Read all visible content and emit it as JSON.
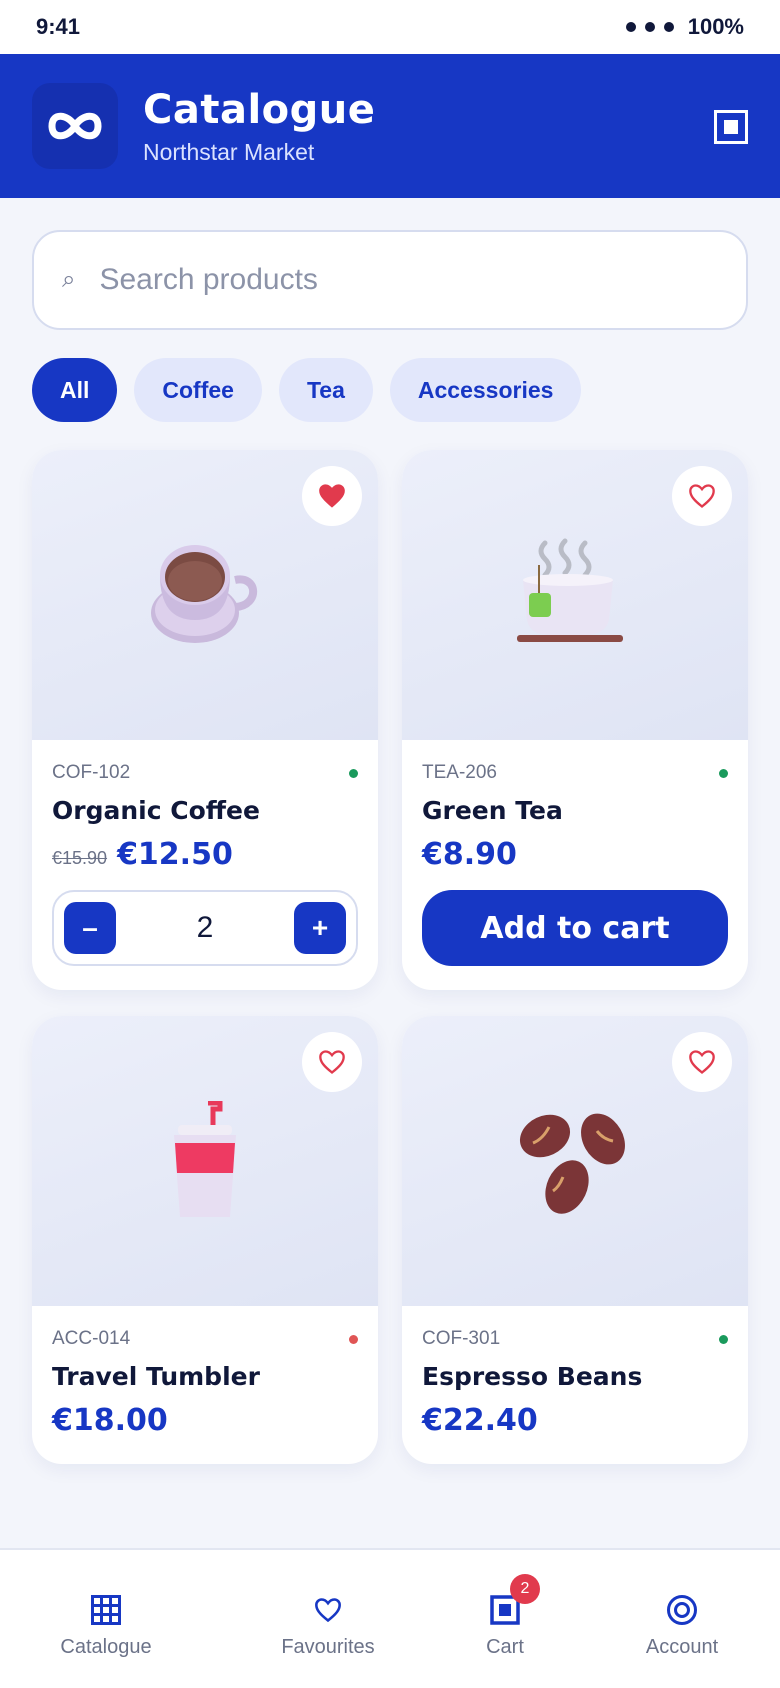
{
  "status_bar": {
    "time": "9:41",
    "battery": "100%"
  },
  "header": {
    "title": "Catalogue",
    "subtitle": "Northstar Market",
    "logo_icon": "infinity-logo-icon",
    "action_icon": "scan-icon"
  },
  "search": {
    "placeholder": "Search products",
    "value": ""
  },
  "filters": [
    {
      "label": "All",
      "active": true
    },
    {
      "label": "Coffee",
      "active": false
    },
    {
      "label": "Tea",
      "active": false
    },
    {
      "label": "Accessories",
      "active": false
    }
  ],
  "products": [
    {
      "sku": "COF-102",
      "name": "Organic Coffee",
      "old_price": "€15.90",
      "price": "€12.50",
      "favorited": true,
      "in_stock": true,
      "quantity": "2",
      "image": "coffee-cup"
    },
    {
      "sku": "TEA-206",
      "name": "Green Tea",
      "price": "€8.90",
      "favorited": false,
      "in_stock": true,
      "cta": "Add to cart",
      "image": "tea-cup"
    },
    {
      "sku": "ACC-014",
      "name": "Travel Tumbler",
      "price": "€18.00",
      "favorited": false,
      "in_stock": false,
      "image": "tumbler"
    },
    {
      "sku": "COF-301",
      "name": "Espresso Beans",
      "price": "€22.40",
      "favorited": false,
      "in_stock": true,
      "image": "coffee-beans"
    }
  ],
  "stepper": {
    "minus": "–",
    "plus": "+"
  },
  "bottom_nav": [
    {
      "label": "Catalogue",
      "icon": "grid-icon",
      "active": true
    },
    {
      "label": "Favourites",
      "icon": "heart-icon",
      "active": false
    },
    {
      "label": "Cart",
      "icon": "cart-icon",
      "active": false,
      "badge": "2"
    },
    {
      "label": "Account",
      "icon": "account-icon",
      "active": false
    }
  ],
  "colors": {
    "primary": "#1737c4",
    "favorite": "#e13a4d",
    "in_stock": "#1a9a5c",
    "out_of_stock": "#e05555"
  }
}
